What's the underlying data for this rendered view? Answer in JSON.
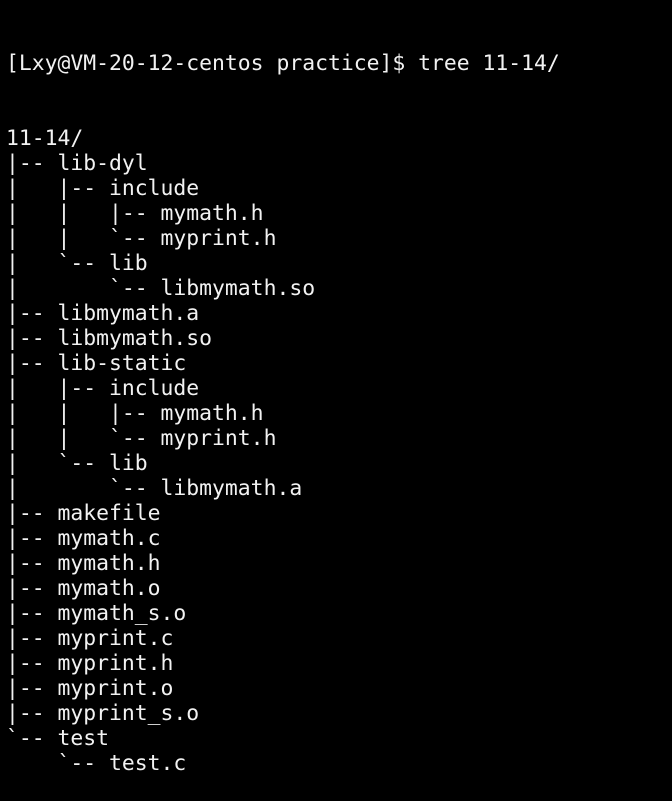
{
  "terminal": {
    "prompt": "[Lxy@VM-20-12-centos practice]$ tree 11-14/",
    "output": [
      "11-14/",
      "|-- lib-dyl",
      "|   |-- include",
      "|   |   |-- mymath.h",
      "|   |   `-- myprint.h",
      "|   `-- lib",
      "|       `-- libmymath.so",
      "|-- libmymath.a",
      "|-- libmymath.so",
      "|-- lib-static",
      "|   |-- include",
      "|   |   |-- mymath.h",
      "|   |   `-- myprint.h",
      "|   `-- lib",
      "|       `-- libmymath.a",
      "|-- makefile",
      "|-- mymath.c",
      "|-- mymath.h",
      "|-- mymath.o",
      "|-- mymath_s.o",
      "|-- myprint.c",
      "|-- myprint.h",
      "|-- myprint.o",
      "|-- myprint_s.o",
      "`-- test",
      "    `-- test.c"
    ]
  }
}
